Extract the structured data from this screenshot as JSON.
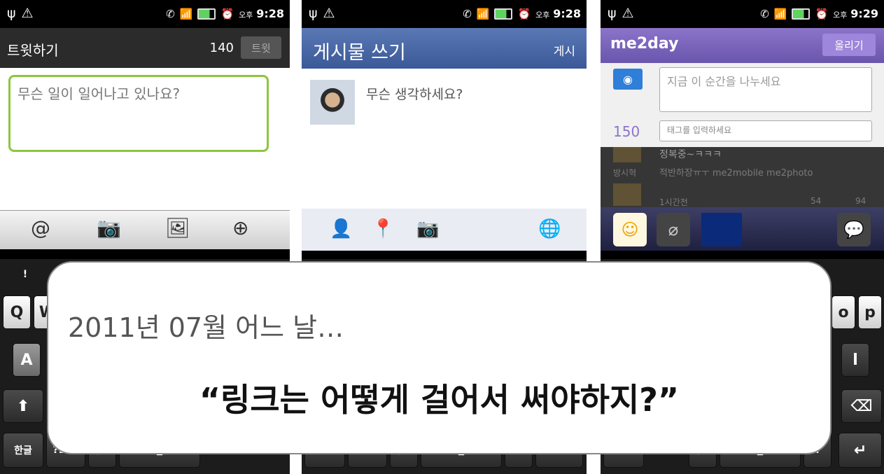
{
  "status_bars": [
    {
      "ampm": "오후",
      "time": "9:28"
    },
    {
      "ampm": "오후",
      "time": "9:28"
    },
    {
      "ampm": "오후",
      "time": "9:29"
    }
  ],
  "twitter": {
    "title": "트윗하기",
    "char_count": "140",
    "tweet_button": "트윗",
    "placeholder": "무슨 일이 일어나고 있나요?",
    "toolbar_icons": [
      "at-icon",
      "camera-icon",
      "gallery-icon",
      "location-icon"
    ]
  },
  "facebook": {
    "title": "게시물 쓰기",
    "post_button": "게시",
    "placeholder": "무슨 생각하세요?",
    "toolbar_icons": [
      "tag-friend-icon",
      "location-pin-icon",
      "camera-icon",
      "globe-icon"
    ]
  },
  "me2day": {
    "logo": "me2day",
    "upload_button": "올리기",
    "placeholder": "지금 이 순간을 나누세요",
    "char_count": "150",
    "tag_placeholder": "태그를 입력하세요",
    "feed": {
      "line1": "정복중~ㅋㅋㅋ",
      "user": "방시혁",
      "line2": "적반하장ㅠㅜ me2mobile me2photo",
      "time": "1시간전",
      "likes": "54",
      "comments": "94"
    }
  },
  "keyboard": {
    "keys_left": [
      "Q",
      "W",
      "A",
      "!",
      "한글",
      "?123"
    ],
    "keys_right": [
      "o",
      "p",
      "l"
    ]
  },
  "overlay": {
    "subtitle": "2011년 07월 어느 날…",
    "headline": "“링크는 어떻게 걸어서 써야하지?”"
  }
}
